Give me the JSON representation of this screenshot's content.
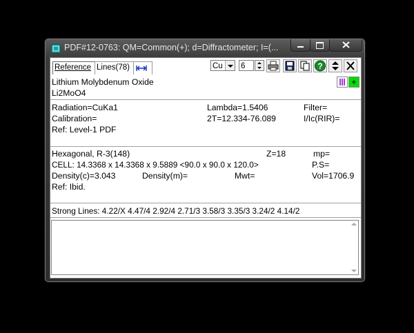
{
  "window": {
    "title": "PDF#12-0763: QM=Common(+); d=Diffractometer; I=(..."
  },
  "tabs": [
    {
      "label": "Reference"
    },
    {
      "label": "Lines(78)"
    }
  ],
  "toolbar": {
    "element_value": "Cu",
    "digits_value": "6"
  },
  "compound": {
    "name": "Lithium Molybdenum Oxide",
    "formula": "Li2MoO4"
  },
  "radiation": {
    "radiation": "Radiation=CuKa1",
    "lambda": "Lambda=1.5406",
    "filter": "Filter=",
    "calibration": "Calibration=",
    "two_theta": "2T=12.334-76.089",
    "rir": "I/Ic(RIR)=",
    "ref": "Ref: Level-1 PDF"
  },
  "crystal": {
    "system": "Hexagonal,  R-3(148)",
    "z": "Z=18",
    "mp": "mp=",
    "cell": "CELL: 14.3368 x 14.3368 x 9.5889 <90.0 x 90.0 x 120.0>",
    "ps": "P.S=",
    "density_c": "Density(c)=3.043",
    "density_m": "Density(m)=",
    "mwt": "Mwt=",
    "vol": "Vol=1706.9",
    "ref": "Ref: Ibid."
  },
  "strong_lines": "Strong Lines: 4.22/X  4.47/4  2.92/4  2.71/3  3.58/3  3.35/3  3.24/2  4.14/2",
  "colors": {
    "accent_green": "#00e000",
    "swatch_purple": "#a040d0"
  }
}
